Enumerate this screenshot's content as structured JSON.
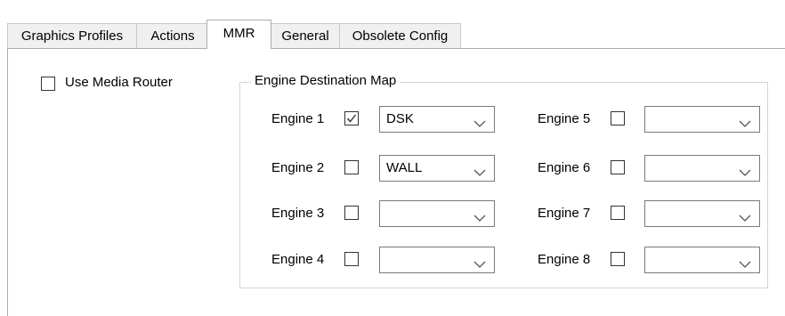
{
  "tabs": [
    {
      "label": "Graphics Profiles",
      "active": false
    },
    {
      "label": "Actions",
      "active": false
    },
    {
      "label": "MMR",
      "active": true
    },
    {
      "label": "General",
      "active": false
    },
    {
      "label": "Obsolete Config",
      "active": false
    }
  ],
  "media_router": {
    "label": "Use Media Router",
    "checked": false
  },
  "engine_map": {
    "title": "Engine Destination Map",
    "engines": [
      {
        "label": "Engine 1",
        "checked": true,
        "destination": "DSK"
      },
      {
        "label": "Engine 2",
        "checked": false,
        "destination": "WALL"
      },
      {
        "label": "Engine 3",
        "checked": false,
        "destination": ""
      },
      {
        "label": "Engine 4",
        "checked": false,
        "destination": ""
      },
      {
        "label": "Engine 5",
        "checked": false,
        "destination": ""
      },
      {
        "label": "Engine 6",
        "checked": false,
        "destination": ""
      },
      {
        "label": "Engine 7",
        "checked": false,
        "destination": ""
      },
      {
        "label": "Engine 8",
        "checked": false,
        "destination": ""
      }
    ]
  },
  "icons": {
    "checkbox_check": "check-icon",
    "combo_arrow": "chevron-down-icon"
  },
  "colors": {
    "tab_bg": "#f0f0f0",
    "border": "#adadad",
    "check": "#333333"
  }
}
